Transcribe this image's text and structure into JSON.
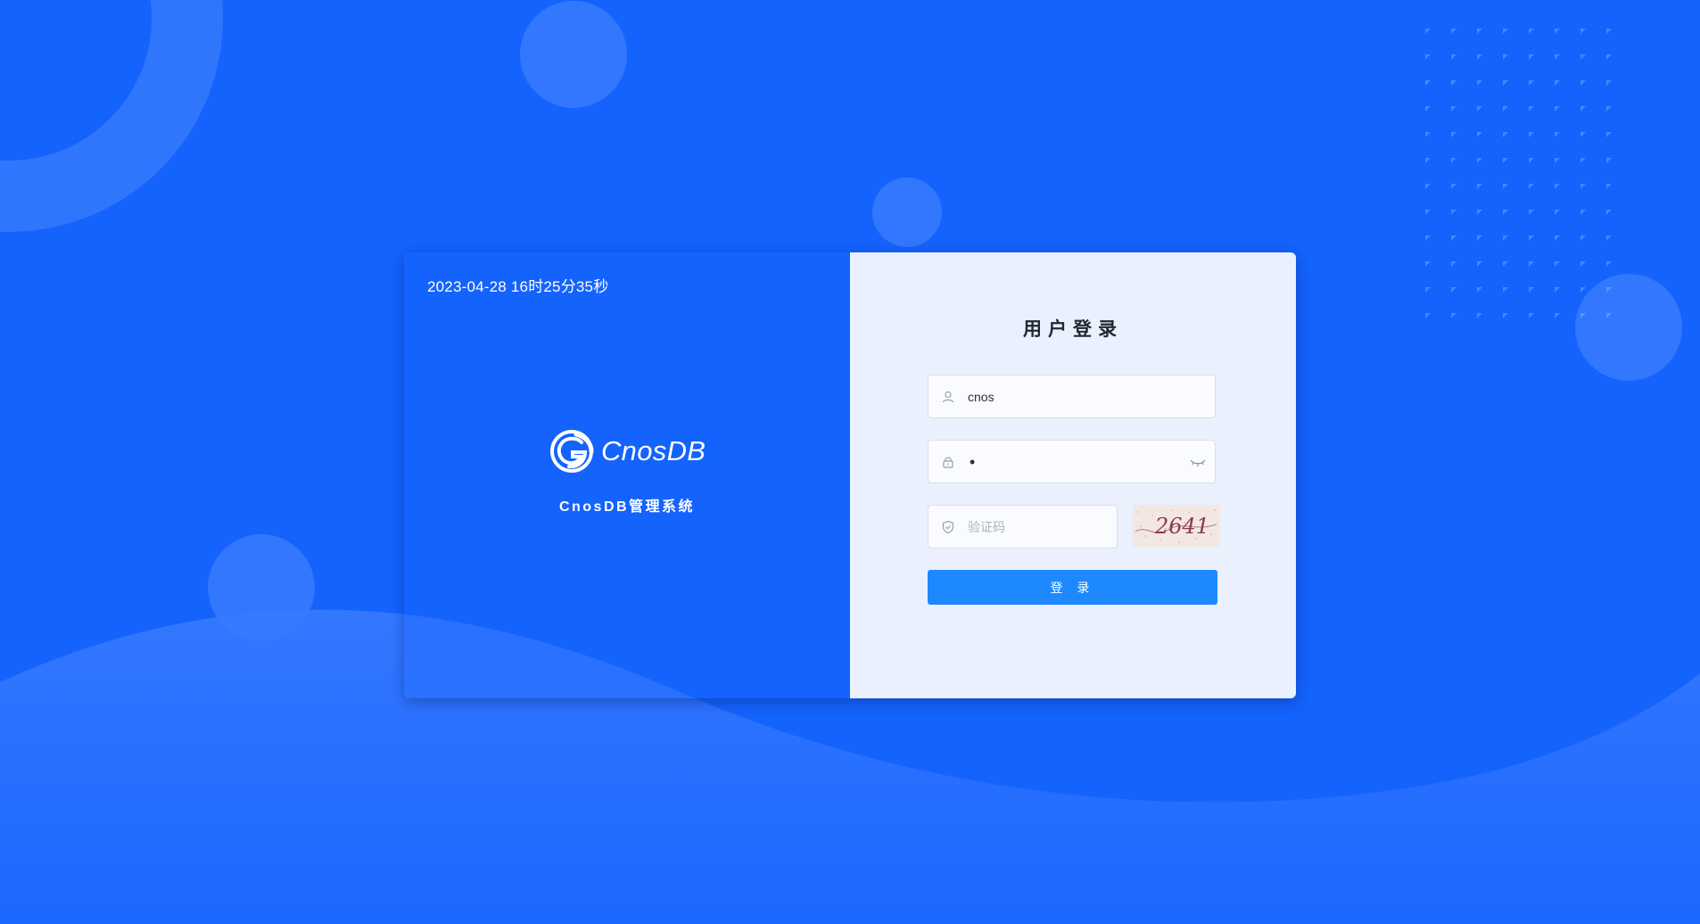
{
  "brand": {
    "datetime": "2023-04-28 16时25分35秒",
    "logo_text": "CnosDB",
    "system_name": "CnosDB管理系统"
  },
  "login": {
    "title": "用户登录",
    "username_value": "cnos",
    "password_masked": "•",
    "captcha_placeholder": "验证码",
    "captcha_code": "2641",
    "submit_label": "登 录"
  },
  "icons": {
    "username": "user-icon",
    "password": "lock-icon",
    "captcha": "shield-icon",
    "toggle_password": "eye-closed-icon",
    "logo": "cnosdb-logo-icon"
  },
  "colors": {
    "background": "#1463fd",
    "form_panel": "#eaf0fd",
    "button": "#1e88ff",
    "title_text": "#222831"
  }
}
